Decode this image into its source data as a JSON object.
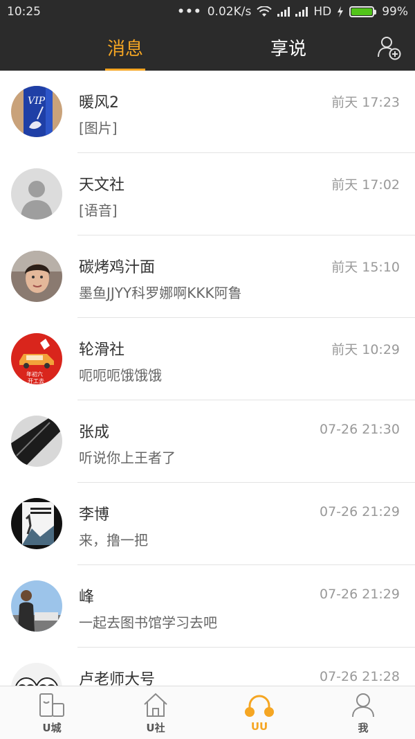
{
  "status_bar": {
    "time": "10:25",
    "dots": "•••",
    "network_speed": "0.02K/s",
    "network_type": "HD",
    "battery_percent": "99%",
    "battery_level": 0.99,
    "battery_color": "#52c41a"
  },
  "header": {
    "tabs": [
      {
        "label": "消息",
        "active": true
      },
      {
        "label": "享说",
        "active": false
      }
    ],
    "add_friend_icon": "add-person-icon",
    "accent_color": "#f5a623"
  },
  "conversations": [
    {
      "name": "暖风2",
      "preview": "[图片]",
      "time": "前天 17:23",
      "avatar": "vip-card-photo"
    },
    {
      "name": "天文社",
      "preview": "[语音]",
      "time": "前天 17:02",
      "avatar": "default-person"
    },
    {
      "name": "碳烤鸡汁面",
      "preview": "墨鱼JJYY科罗娜啊KKK阿鲁",
      "time": "前天 15:10",
      "avatar": "selfie-photo"
    },
    {
      "name": "轮滑社",
      "preview": "呃呃呃饿饿饿",
      "time": "前天 10:29",
      "avatar": "red-poster",
      "avatar_text_1": "年初六",
      "avatar_text_2": "开工去"
    },
    {
      "name": "张成",
      "preview": "听说你上王者了",
      "time": "07-26 21:30",
      "avatar": "dark-phone-photo"
    },
    {
      "name": "李博",
      "preview": "来，撸一把",
      "time": "07-26 21:29",
      "avatar": "book-cover"
    },
    {
      "name": "峰",
      "preview": "一起去图书馆学习去吧",
      "time": "07-26 21:29",
      "avatar": "outdoor-photo"
    },
    {
      "name": "卢老师大号",
      "preview": "",
      "time": "07-26 21:28",
      "avatar": "cartoon-faces"
    }
  ],
  "bottom_nav": [
    {
      "label": "U城",
      "icon": "city-icon",
      "active": false
    },
    {
      "label": "U社",
      "icon": "home-icon",
      "active": false
    },
    {
      "label": "UU",
      "icon": "headphones-icon",
      "active": true
    },
    {
      "label": "我",
      "icon": "person-icon",
      "active": false
    }
  ]
}
